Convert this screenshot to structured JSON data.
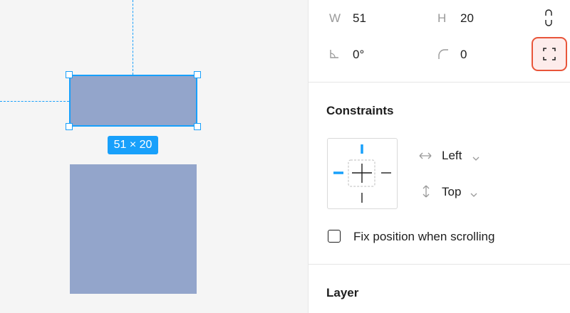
{
  "colors": {
    "selection": "#18a0fb",
    "shape_fill": "#93a5cb",
    "highlight": "#e8553a",
    "canvas_bg": "#f5f5f5"
  },
  "canvas": {
    "size_label": "51 × 20"
  },
  "dimensions": {
    "w_label": "W",
    "w_value": "51",
    "h_label": "H",
    "h_value": "20",
    "rotation_value": "0°",
    "radius_value": "0"
  },
  "constraints": {
    "title": "Constraints",
    "horizontal": "Left",
    "vertical": "Top",
    "fix_position_label": "Fix position when scrolling",
    "fix_position_checked": false
  },
  "layer": {
    "title": "Layer"
  },
  "icons": {
    "rotation": "angle-icon",
    "radius": "corner-radius-icon",
    "constrain": "link-proportions-icon",
    "clip": "clip-content-icon",
    "horizontal": "arrows-horizontal-icon",
    "vertical": "arrows-vertical-icon",
    "dropdown": "chevron-down-icon"
  }
}
